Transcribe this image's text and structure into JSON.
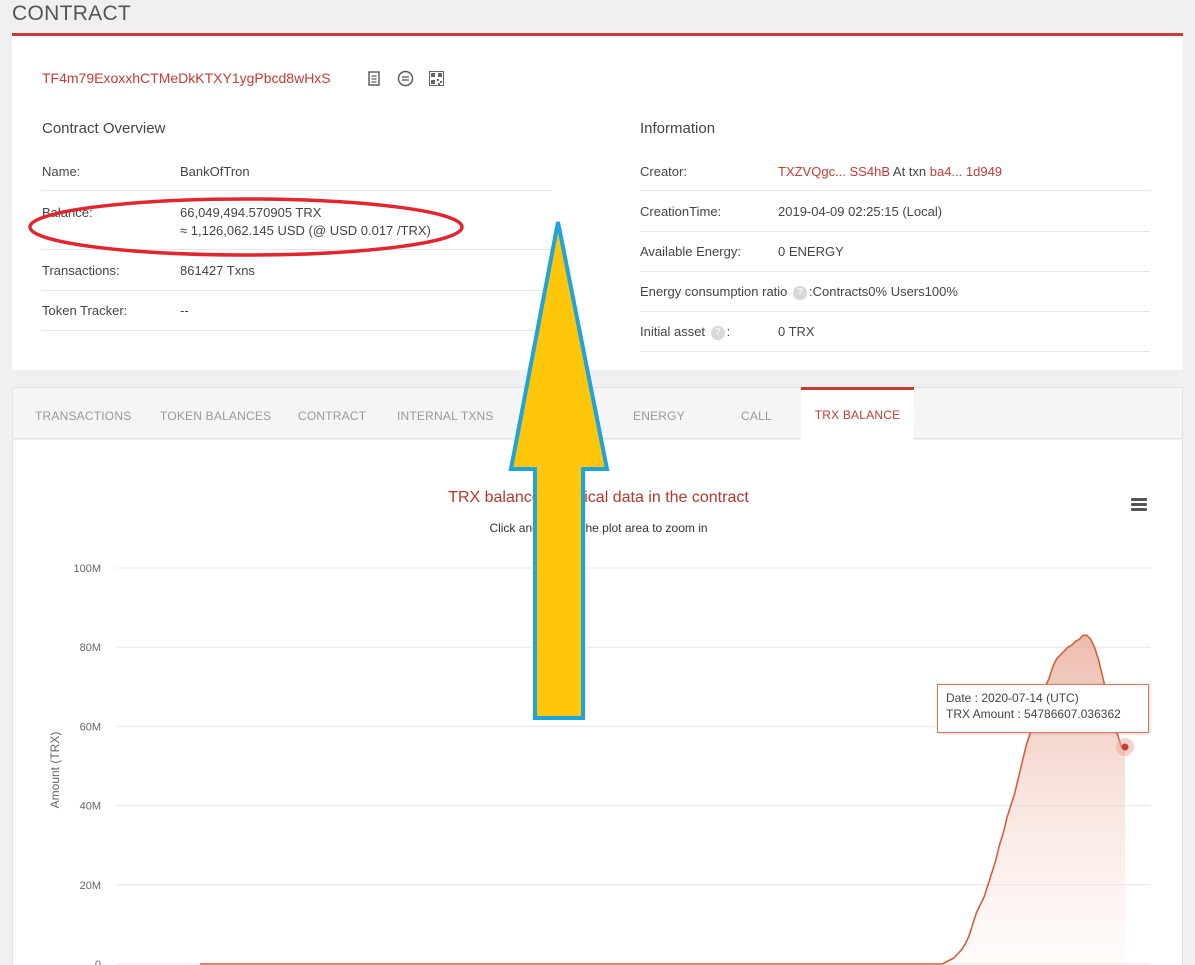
{
  "page": {
    "title": "CONTRACT"
  },
  "contract": {
    "address": "TF4m79ExoxxhCTMeDkKTXY1ygPbcd8wHxS"
  },
  "overview": {
    "title": "Contract Overview",
    "name_label": "Name:",
    "name_value": "BankOfTron",
    "balance_label": "Balance:",
    "balance_trx": "66,049,494.570905 TRX",
    "balance_usd": "≈ 1,126,062.145 USD (@ USD 0.017 /TRX)",
    "transactions_label": "Transactions:",
    "transactions_value": "861427  Txns",
    "token_tracker_label": "Token Tracker:",
    "token_tracker_value": "--"
  },
  "information": {
    "title": "Information",
    "creator_label": "Creator:",
    "creator_address": "TXZVQgc... SS4hB",
    "creator_at_txn": " At txn ",
    "creator_txn": "ba4... 1d949",
    "creation_time_label": "CreationTime:",
    "creation_time_value": "2019-04-09 02:25:15 (Local)",
    "energy_label": "Available Energy:",
    "energy_value": "0  ENERGY",
    "ratio_label": "Energy consumption ratio",
    "ratio_value": ":Contracts0%  Users100%",
    "initial_asset_label": "Initial asset",
    "initial_asset_colon": ":",
    "initial_asset_value": "0 TRX",
    "help_glyph": "?"
  },
  "tabs": [
    {
      "label": "TRANSACTIONS"
    },
    {
      "label": "TOKEN BALANCES"
    },
    {
      "label": "CONTRACT"
    },
    {
      "label": "INTERNAL TXNS"
    },
    {
      "label": "ENERGY"
    },
    {
      "label": "CALL"
    },
    {
      "label": "TRX BALANCE"
    }
  ],
  "tooltip": {
    "date_line": "Date : 2020-07-14 (UTC)",
    "amount_line": "TRX Amount : 54786607.036362"
  },
  "colors": {
    "accent": "#c33c36",
    "annotation_ellipse": "#e0262f",
    "arrow_fill": "#ffc60a",
    "arrow_stroke": "#1ea3dc"
  },
  "icons": [
    "copy-icon",
    "transfer-icon",
    "qrcode-icon",
    "menu-icon"
  ],
  "chart_data": {
    "type": "area",
    "title": "TRX balance historical data in the contract",
    "subtitle": "Click and drag in the plot area to zoom in",
    "ylabel": "Amount (TRX)",
    "yticks": [
      "100M",
      "80M",
      "60M",
      "40M",
      "20M",
      "0"
    ],
    "ylim": [
      0,
      100000000
    ],
    "grid": true,
    "series": [
      {
        "values": [
          0,
          0,
          0,
          0,
          0,
          0,
          0,
          0,
          0,
          0,
          0,
          0,
          0,
          0,
          0,
          0,
          0,
          0,
          0,
          0,
          0,
          0,
          0,
          0,
          0,
          0,
          0,
          0,
          0,
          0,
          0,
          0,
          0,
          0,
          0,
          0,
          0,
          0,
          0,
          0,
          0,
          0,
          0,
          0,
          0,
          0,
          0,
          0,
          0,
          0,
          0,
          0,
          0,
          0,
          0,
          0,
          0,
          0,
          0,
          0,
          0,
          0,
          0,
          0,
          0,
          0,
          0,
          0,
          0,
          0,
          0,
          0,
          0,
          0,
          0,
          0,
          0,
          0,
          0,
          0,
          0,
          0,
          0,
          0,
          0,
          0,
          0,
          0,
          0,
          0,
          0,
          0,
          0,
          0,
          0,
          0,
          0,
          0,
          0,
          0,
          0,
          0,
          0,
          0,
          0,
          0,
          0,
          0,
          0,
          0,
          0,
          0,
          0,
          0,
          0,
          0,
          0,
          0,
          0,
          0,
          0,
          0,
          0,
          0,
          0,
          0,
          0,
          0,
          0,
          0,
          0,
          0,
          0,
          0,
          0,
          0,
          0,
          0,
          0,
          0,
          0,
          0,
          0,
          0,
          0,
          0,
          0,
          0,
          0,
          0,
          0,
          0,
          0,
          0,
          0,
          0,
          0,
          0,
          0,
          0,
          0,
          0,
          0,
          0,
          0,
          0,
          0,
          0,
          0,
          0,
          0,
          0,
          0,
          0,
          0,
          0,
          0,
          0,
          0,
          0,
          0,
          0,
          0,
          0,
          0,
          0,
          0,
          0,
          0,
          0,
          0,
          0,
          0,
          0,
          0,
          0,
          500000,
          1000000,
          1500000,
          2500000,
          3500000,
          5000000,
          7000000,
          10000000,
          13000000,
          15000000,
          17000000,
          20000000,
          23000000,
          26000000,
          30000000,
          33000000,
          37000000,
          40000000,
          43000000,
          47000000,
          51000000,
          55000000,
          58000000,
          62000000,
          65000000,
          68000000,
          70000000,
          72000000,
          75000000,
          77000000,
          78000000,
          79000000,
          80000000,
          80500000,
          81500000,
          82000000,
          83000000,
          83000000,
          82000000,
          80000000,
          77000000,
          73000000,
          69000000,
          65000000,
          61000000,
          58000000,
          55000000,
          54786607
        ]
      }
    ]
  }
}
